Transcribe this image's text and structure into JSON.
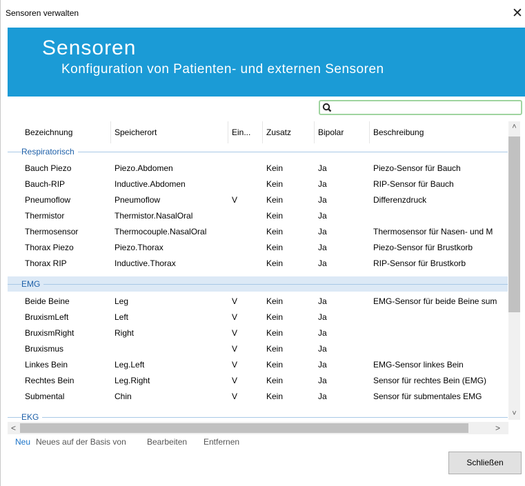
{
  "window": {
    "title": "Sensoren verwalten",
    "close_glyph": "✕"
  },
  "banner": {
    "title": "Sensoren",
    "subtitle": "Konfiguration von Patienten- und externen Sensoren"
  },
  "search": {
    "value": "",
    "placeholder": ""
  },
  "table": {
    "columns": [
      "Bezeichnung",
      "Speicherort",
      "Ein...",
      "Zusatz",
      "Bipolar",
      "Beschreibung"
    ],
    "groups": [
      {
        "name": "Respiratorisch",
        "rows": [
          [
            "Bauch Piezo",
            "Piezo.Abdomen",
            "",
            "Kein",
            "Ja",
            "Piezo-Sensor für Bauch"
          ],
          [
            "Bauch-RIP",
            "Inductive.Abdomen",
            "",
            "Kein",
            "Ja",
            "RIP-Sensor für Bauch"
          ],
          [
            "Pneumoflow",
            "Pneumoflow",
            "V",
            "Kein",
            "Ja",
            "Differenzdruck"
          ],
          [
            "Thermistor",
            "Thermistor.NasalOral",
            "",
            "Kein",
            "Ja",
            ""
          ],
          [
            "Thermosensor",
            "Thermocouple.NasalOral",
            "",
            "Kein",
            "Ja",
            "Thermosensor für Nasen- und M"
          ],
          [
            "Thorax Piezo",
            "Piezo.Thorax",
            "",
            "Kein",
            "Ja",
            "Piezo-Sensor für Brustkorb"
          ],
          [
            "Thorax RIP",
            "Inductive.Thorax",
            "",
            "Kein",
            "Ja",
            "RIP-Sensor für Brustkorb"
          ]
        ]
      },
      {
        "name": "EMG",
        "rows": [
          [
            "Beide Beine",
            "Leg",
            "V",
            "Kein",
            "Ja",
            "EMG-Sensor für beide Beine sum"
          ],
          [
            "BruxismLeft",
            "Left",
            "V",
            "Kein",
            "Ja",
            ""
          ],
          [
            "BruxismRight",
            "Right",
            "V",
            "Kein",
            "Ja",
            ""
          ],
          [
            "Bruxismus",
            "",
            "V",
            "Kein",
            "Ja",
            ""
          ],
          [
            "Linkes Bein",
            "Leg.Left",
            "V",
            "Kein",
            "Ja",
            "EMG-Sensor linkes Bein"
          ],
          [
            "Rechtes Bein",
            "Leg.Right",
            "V",
            "Kein",
            "Ja",
            "Sensor für rechtes Bein (EMG)"
          ],
          [
            "Submental",
            "Chin",
            "V",
            "Kein",
            "Ja",
            "Sensor für submentales EMG"
          ]
        ]
      },
      {
        "name": "EKG",
        "rows": []
      }
    ]
  },
  "scrollbars": {
    "up": "˄",
    "down": "˅",
    "left": "<",
    "right": ">"
  },
  "footer": {
    "links": [
      "Neu",
      "Neues auf der Basis von",
      "Bearbeiten",
      "Entfernen"
    ],
    "close_button": "Schließen"
  },
  "colors": {
    "banner": "#1b9bd6",
    "group_text": "#1c5fa8",
    "link_primary": "#1a73c8",
    "search_border": "#9fd49f"
  }
}
